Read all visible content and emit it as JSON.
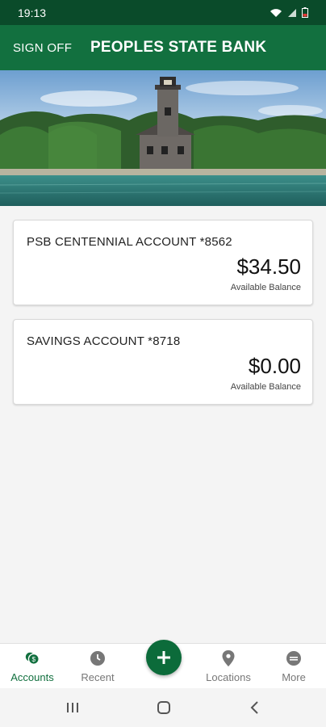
{
  "status": {
    "time": "19:13"
  },
  "header": {
    "sign_off": "SIGN OFF",
    "title": "PEOPLES STATE BANK"
  },
  "hero": {
    "icon": "lighthouse-photo"
  },
  "accounts": [
    {
      "name": "PSB CENTENNIAL ACCOUNT *8562",
      "balance": "$34.50",
      "balance_label": "Available Balance"
    },
    {
      "name": "SAVINGS ACCOUNT *8718",
      "balance": "$0.00",
      "balance_label": "Available Balance"
    }
  ],
  "nav": {
    "accounts": "Accounts",
    "recent": "Recent",
    "locations": "Locations",
    "more": "More"
  },
  "colors": {
    "brand": "#12703f",
    "brand_dark": "#0a4b2a",
    "active": "#12703f",
    "inactive": "#777777"
  }
}
